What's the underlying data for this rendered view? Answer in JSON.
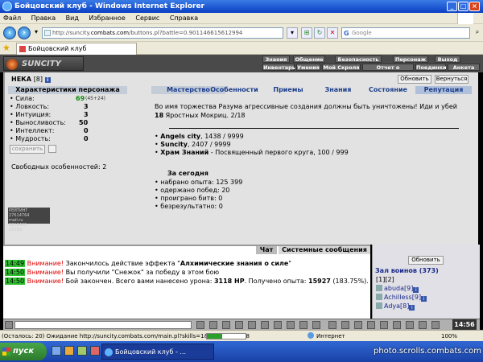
{
  "browser": {
    "window_title": "Бойцовский клуб - Windows Internet Explorer",
    "menu": [
      "Файл",
      "Правка",
      "Вид",
      "Избранное",
      "Сервис",
      "Справка"
    ],
    "url_prefix": "http://suncity.",
    "url_domain": "combats.com",
    "url_suffix": "/buttons.pl?battle=0.901146615612994",
    "search_placeholder": "Google",
    "search_logo": "G",
    "tab_title": "Бойцовский клуб",
    "status_text": "(Осталось: 20) Ожидание http://suncity.combats.com/main.pl?skills=1&rand=0.76908",
    "progress": 0.4,
    "zone_text": "Интернет",
    "zoom_text": "100%"
  },
  "game": {
    "logo_text": "SUNCITY",
    "nav_top": [
      "Знания",
      "Общение",
      "Безопасность",
      "Персонаж",
      "Выход"
    ],
    "nav_bottom": [
      "Инвентарь",
      "Умения",
      "Мой Скроля",
      "Отчет о переводах",
      "Поединки",
      "Анкета"
    ],
    "nick": "НЕКА",
    "level": "[8]",
    "info_glyph": "i",
    "refresh_btn": "Обновить",
    "return_btn": "Вернуться",
    "char_header": "Характеристики персонажа",
    "tabs": [
      "Мастерство",
      "Особенности",
      "Приемы",
      "Знания",
      "Состояние",
      "Репутация"
    ],
    "stats": [
      {
        "label": "• Сила:",
        "value": "69",
        "extra": "(45+24)"
      },
      {
        "label": "• Ловкость:",
        "value": "3",
        "extra": ""
      },
      {
        "label": "• Интуиция:",
        "value": "3",
        "extra": ""
      },
      {
        "label": "• Выносливость:",
        "value": "50",
        "extra": ""
      },
      {
        "label": "• Интеллект:",
        "value": "0",
        "extra": ""
      },
      {
        "label": "• Мудрость:",
        "value": "0",
        "extra": ""
      }
    ],
    "save_btn": "сохранить",
    "free_features": "Свободных особенностей: 2",
    "counter_lines": [
      "РЕЙТИНГ 27614764",
      "mail.ru",
      "6818469",
      "27159"
    ],
    "narrative_text": "Во имя торжества Разума агрессивные создания должны быть уничтожены! Иди и убей ",
    "narrative_count": "18",
    "narrative_tail": " Яростных Мокриц. 2/18",
    "cities": [
      {
        "name": "Angels city",
        "value": ", 1438 / 9999"
      },
      {
        "name": "Suncity",
        "value": ", 2407 / 9999"
      },
      {
        "name": "Храм Знаний",
        "value": " - Посвященный первого круга, 100 / 999"
      }
    ],
    "today_title": "За сегодня",
    "daily": [
      "• набрано опыта: 125 399",
      "• одержано побед: 20",
      "• проиграно битв: 0",
      "• безрезультатно: 0"
    ]
  },
  "chat": {
    "tabs": [
      "Чат",
      "Системные сообщения"
    ],
    "messages": [
      {
        "time": "14:49",
        "warn": "Внимание!",
        "text": " Закончилось действие эффекта \"",
        "bold": "Алхимические знания о силе",
        "tail": "\""
      },
      {
        "time": "14:50",
        "warn": "Внимание!",
        "text": " Вы получили \"Снежок\" за победу в этом бою",
        "bold": "",
        "tail": ""
      },
      {
        "time": "14:50",
        "warn": "Внимание!",
        "text": " Бой закончен. Всего вами нанесено урона: ",
        "bold": "3118 HP",
        "tail": ". Получено опыта: ",
        "bold2": "15927",
        "tail2": " (183.75%)."
      }
    ]
  },
  "sidebar": {
    "refresh_btn": "Обновить",
    "hall_name": "Зал воинов (373)",
    "pages": "[1][2]",
    "players": [
      {
        "name": "abuda",
        "level": "[9]"
      },
      {
        "name": "Achilless",
        "level": "[9]"
      },
      {
        "name": "Adya",
        "level": "[8]"
      }
    ]
  },
  "toolbar": {
    "clock": "14:56"
  },
  "taskbar": {
    "start": "пуск",
    "task_item": "Бойцовский клуб - ...",
    "watermark": "photo.scrolls.combats.com"
  }
}
